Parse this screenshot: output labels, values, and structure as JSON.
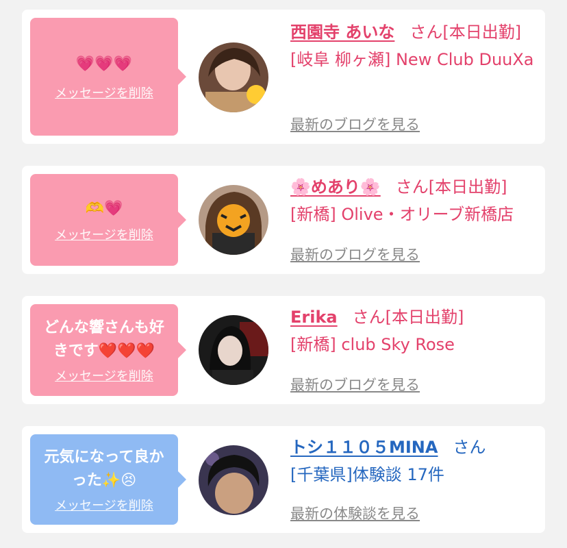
{
  "delete_label": "メッセージを削除",
  "colors": {
    "pink_bubble": "#fa9bb0",
    "blue_bubble": "#8fbaf3",
    "pink_text": "#e3416b",
    "blue_text": "#2567bf",
    "link_gray": "#888888"
  },
  "cards": [
    {
      "message": "💗💗💗",
      "name": "西園寺 あいな",
      "suffix": "さん[本日出勤]",
      "shop": "[岐阜 柳ヶ瀬] New Club DuuXa",
      "link": "最新のブログを見る"
    },
    {
      "message": "🫶💗",
      "name": "🌸めあり🌸",
      "suffix": "さん[本日出勤]",
      "shop": "[新橋] Olive・オリーブ新橋店",
      "link": "最新のブログを見る"
    },
    {
      "message": "どんな響さんも好きです❤️❤️❤️",
      "name": "Erika",
      "suffix": "さん[本日出勤]",
      "shop": "[新橋] club Sky Rose",
      "link": "最新のブログを見る"
    },
    {
      "message": "元気になって良かった✨😣",
      "name": "トシ１１０５MINA",
      "suffix": "さん",
      "shop": "[千葉県]体験談 17件",
      "link": "最新の体験談を見る"
    }
  ]
}
